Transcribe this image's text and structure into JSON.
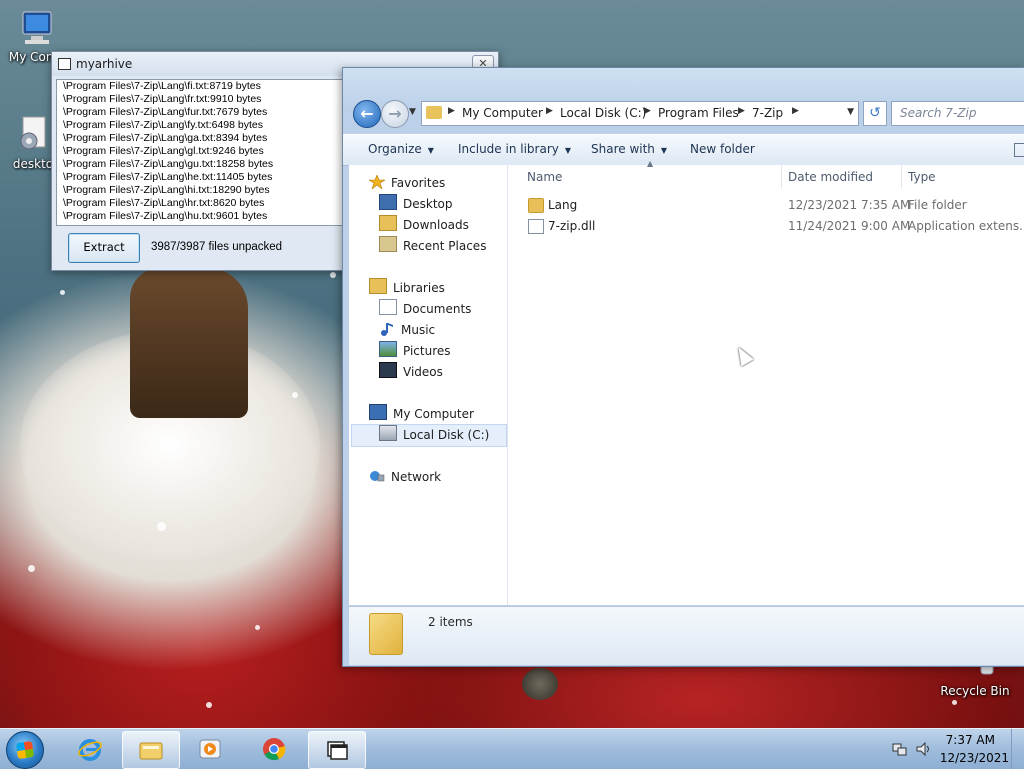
{
  "desktop": {
    "icons": [
      {
        "label": "My Comp",
        "name": "my-computer"
      },
      {
        "label": "deskto",
        "name": "desktop-gadget"
      },
      {
        "label": "Recycle Bin",
        "name": "recycle-bin"
      }
    ]
  },
  "zip_dialog": {
    "title": "myarhive",
    "close_glyph": "✕",
    "files": [
      "\\Program Files\\7-Zip\\Lang\\fi.txt:8719 bytes",
      "\\Program Files\\7-Zip\\Lang\\fr.txt:9910 bytes",
      "\\Program Files\\7-Zip\\Lang\\fur.txt:7679 bytes",
      "\\Program Files\\7-Zip\\Lang\\fy.txt:6498 bytes",
      "\\Program Files\\7-Zip\\Lang\\ga.txt:8394 bytes",
      "\\Program Files\\7-Zip\\Lang\\gl.txt:9246 bytes",
      "\\Program Files\\7-Zip\\Lang\\gu.txt:18258 bytes",
      "\\Program Files\\7-Zip\\Lang\\he.txt:11405 bytes",
      "\\Program Files\\7-Zip\\Lang\\hi.txt:18290 bytes",
      "\\Program Files\\7-Zip\\Lang\\hr.txt:8620 bytes",
      "\\Program Files\\7-Zip\\Lang\\hu.txt:9601 bytes"
    ],
    "extract_label": "Extract",
    "status": "3987/3987 files unpacked"
  },
  "explorer": {
    "breadcrumbs": [
      "My Computer",
      "Local Disk (C:)",
      "Program Files",
      "7-Zip"
    ],
    "search_placeholder": "Search 7-Zip",
    "toolbar": {
      "organize": "Organize",
      "include": "Include in library",
      "share": "Share with",
      "new_folder": "New folder"
    },
    "nav": {
      "favorites": "Favorites",
      "desktop": "Desktop",
      "downloads": "Downloads",
      "recent": "Recent Places",
      "libraries": "Libraries",
      "documents": "Documents",
      "music": "Music",
      "pictures": "Pictures",
      "videos": "Videos",
      "computer": "My Computer",
      "local_disk": "Local Disk (C:)",
      "network": "Network"
    },
    "columns": {
      "name": "Name",
      "date": "Date modified",
      "type": "Type"
    },
    "rows": [
      {
        "name": "Lang",
        "date": "12/23/2021 7:35 AM",
        "type": "File folder",
        "icon": "folder-icon"
      },
      {
        "name": "7-zip.dll",
        "date": "11/24/2021 9:00 AM",
        "type": "Application extens...",
        "icon": "dll-file-icon"
      }
    ],
    "status_items": "2 items"
  },
  "taskbar": {
    "pinned": [
      "internet-explorer-icon",
      "file-explorer-icon",
      "media-player-icon",
      "chrome-icon",
      "7zip-window-icon"
    ],
    "clock_time": "7:37 AM",
    "clock_date": "12/23/2021"
  }
}
